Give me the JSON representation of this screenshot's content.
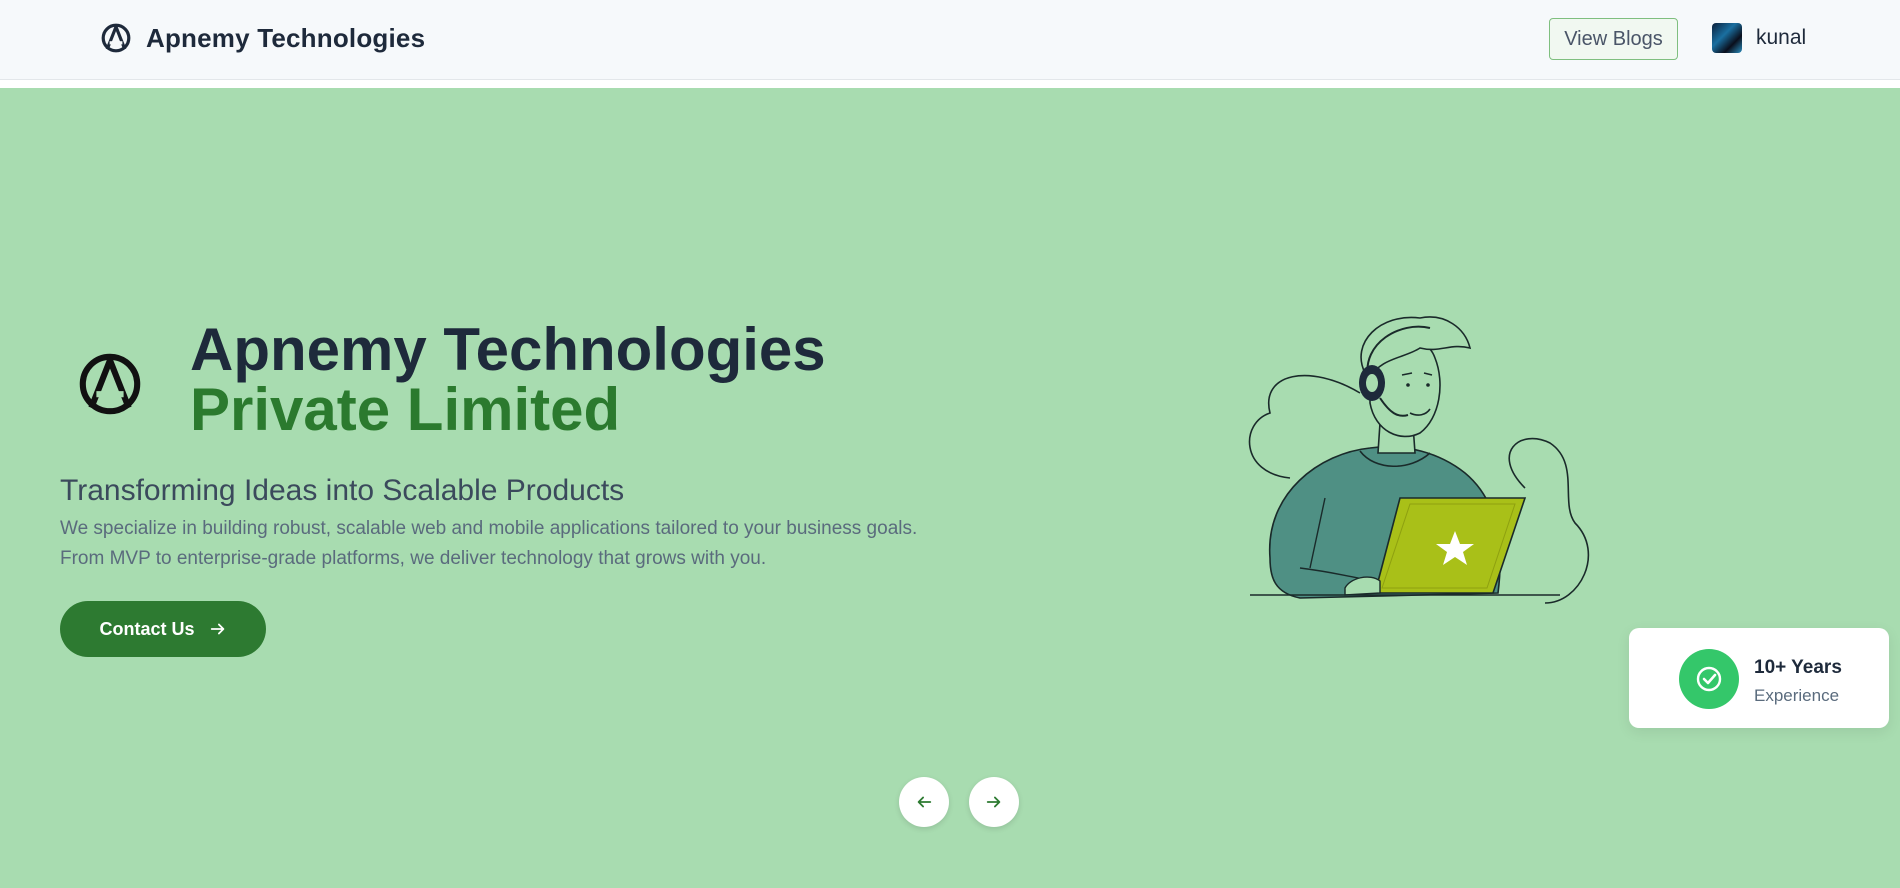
{
  "header": {
    "brand_name": "Apnemy Technologies",
    "view_blogs_label": "View Blogs",
    "username": "kunal"
  },
  "hero": {
    "title_line1": "Apnemy Technologies",
    "title_line2": "Private Limited",
    "tagline": "Transforming Ideas into Scalable Products",
    "description": "We specialize in building robust, scalable web and mobile applications tailored to your business goals. From MVP to enterprise-grade platforms, we deliver technology that grows with you.",
    "cta_label": "Contact Us",
    "experience_value": "10+ Years",
    "experience_label": "Experience"
  },
  "icons": {
    "brand": "apnemy-logo-icon",
    "cta": "arrow-right-icon",
    "prev": "arrow-left-icon",
    "next": "arrow-right-icon",
    "badge": "check-circle-icon"
  },
  "colors": {
    "hero_background": "#a8dcb0",
    "accent_green": "#2d7a31",
    "headline_dark": "#1e2a3b",
    "badge_green": "#34c76a",
    "laptop_lime": "#a9c018",
    "sweater_teal": "#4f9084"
  }
}
